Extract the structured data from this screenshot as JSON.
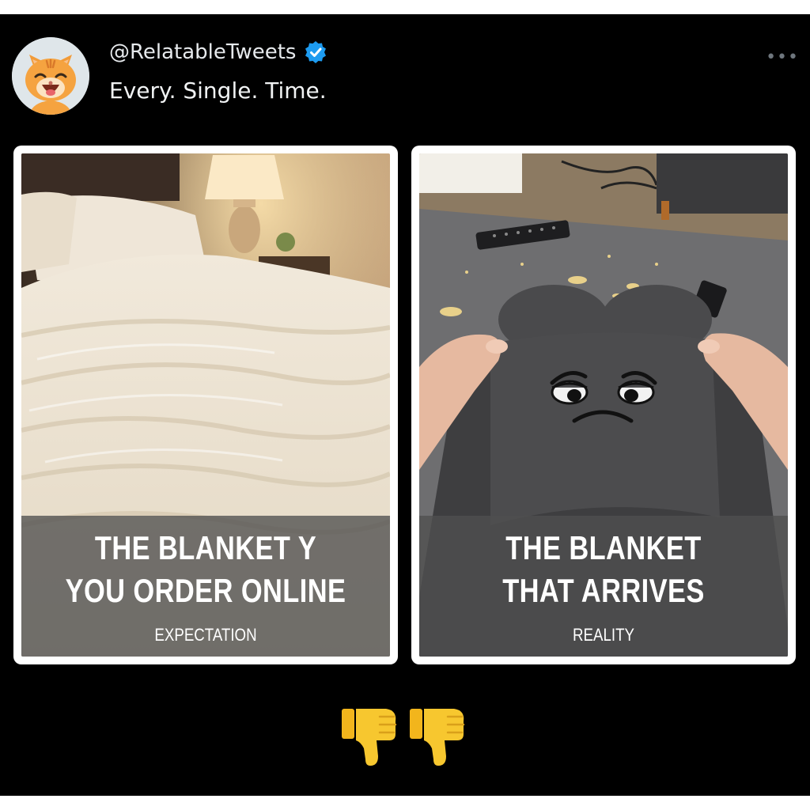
{
  "tweet": {
    "handle": "@RelatableTweets",
    "verified": true,
    "text": "Every. Single. Time.",
    "more_icon": "ellipsis-icon"
  },
  "panels": [
    {
      "title_line1": "THE BLANKET Y",
      "title_line2": "YOU ORDER ONLINE",
      "label": "EXPECTATION"
    },
    {
      "title_line1": "THE BLANKET",
      "title_line2": "THAT ARRIVES",
      "label": "REALITY"
    }
  ],
  "reactions": [
    "thumbs-down-icon",
    "thumbs-down-icon"
  ],
  "colors": {
    "background": "#000000",
    "verified_blue": "#1d9bf0",
    "thumb_yellow": "#f7c72f"
  }
}
